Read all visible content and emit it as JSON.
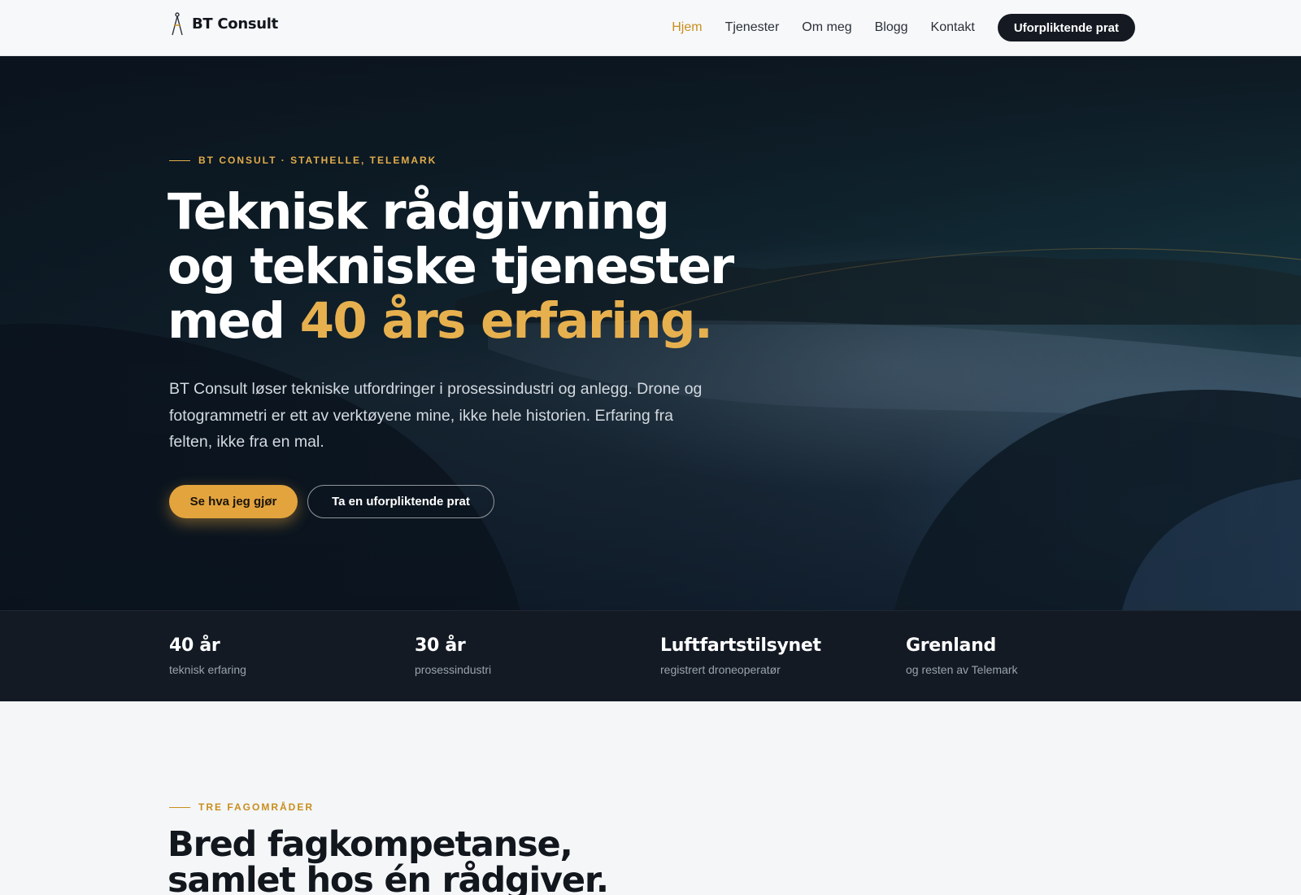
{
  "header": {
    "logo_text": "BT Consult",
    "nav": [
      "Hjem",
      "Tjenester",
      "Om meg",
      "Blogg",
      "Kontakt"
    ],
    "active_nav": "Hjem",
    "cta_label": "Uforpliktende prat"
  },
  "hero": {
    "eyebrow": "BT CONSULT · STATHELLE, TELEMARK",
    "title_line1": "Teknisk rådgivning",
    "title_line2": "og tekniske tjenester",
    "title_line3_prefix": "med ",
    "title_line3_accent": "40 års erfaring.",
    "text": "BT Consult løser tekniske utfordringer i prosessindustri og anlegg. Drone og fotogrammetri er ett av verktøyene mine, ikke hele historien. Erfaring fra felten, ikke fra en mal.",
    "primary_button": "Se hva jeg gjør",
    "secondary_button": "Ta en uforpliktende prat"
  },
  "stats": [
    {
      "value": "40 år",
      "label": "teknisk erfaring"
    },
    {
      "value": "30 år",
      "label": "prosessindustri"
    },
    {
      "value": "Luftfartstilsynet",
      "label": "registrert droneoperatør"
    },
    {
      "value": "Grenland",
      "label": "og resten av Telemark"
    }
  ],
  "section": {
    "eyebrow": "TRE FAGOMRÅDER",
    "title_line1": "Bred fagkompetanse,",
    "title_line2": "samlet hos én rådgiver."
  },
  "colors": {
    "accent": "#e3a43e",
    "accent_text": "#c98e1c",
    "dark": "#131a24",
    "page_bg": "#f4f6f8"
  },
  "icons": {
    "logo": "drafting-compass-icon"
  }
}
